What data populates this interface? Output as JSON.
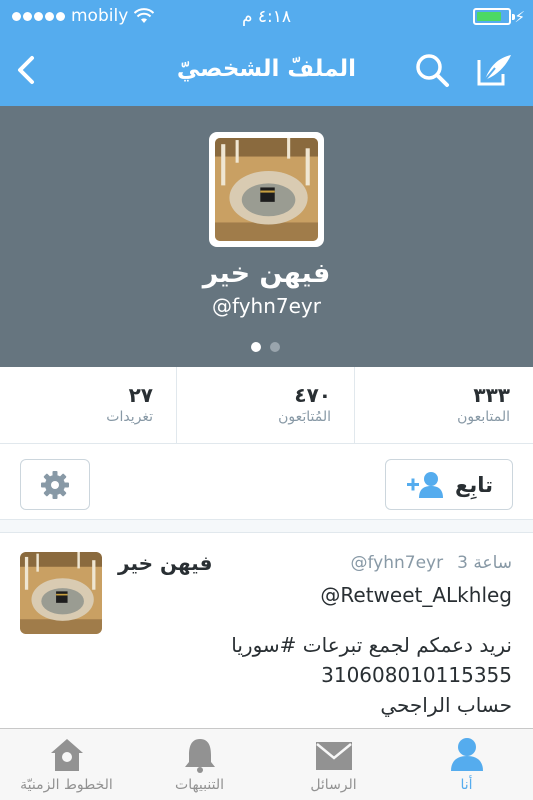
{
  "status_bar": {
    "carrier": "mobily",
    "time": "٤:١٨ م",
    "battery_level": 0.8
  },
  "nav": {
    "title": "الملفّ الشخصيّ"
  },
  "profile": {
    "name": "فيهن خير",
    "handle": "@fyhn7eyr",
    "page_count": 2,
    "active_page": 1
  },
  "stats": [
    {
      "value": "٣٣٣",
      "label": "المتابعون"
    },
    {
      "value": "٤٧٠",
      "label": "المُتابَعون"
    },
    {
      "value": "٢٧",
      "label": "تغريدات"
    }
  ],
  "actions": {
    "follow_label": "تابِع"
  },
  "tweet": {
    "name": "فيهن خير",
    "handle": "@fyhn7eyr",
    "time": "3 ساعة",
    "lines": [
      "@Retweet_ALkhleg",
      "",
      "نريد دعمكم لجمع تبرعات #سوريا",
      "310608010115355",
      "حساب الراجحي"
    ]
  },
  "tabs": [
    {
      "label": "أنا",
      "icon": "person-icon",
      "active": true
    },
    {
      "label": "الرسائل",
      "icon": "envelope-icon",
      "active": false
    },
    {
      "label": "التنبيهات",
      "icon": "bell-icon",
      "active": false
    },
    {
      "label": "الخطوط الزمنيّة",
      "icon": "home-icon",
      "active": false
    }
  ],
  "colors": {
    "accent": "#55acee",
    "header_bg": "#66757f",
    "muted": "#8899a6",
    "tab_inactive": "#929292"
  }
}
